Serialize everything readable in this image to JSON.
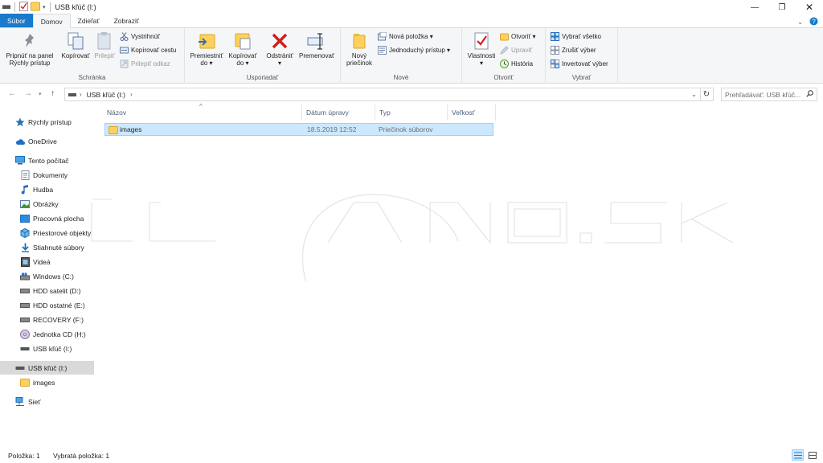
{
  "window": {
    "title": "USB kľúč (I:)",
    "controls": {
      "minimize": "—",
      "maximize": "❐",
      "close": "✕"
    }
  },
  "ribbon_tabs": [
    "Súbor",
    "Domov",
    "Zdieľať",
    "Zobraziť"
  ],
  "ribbon": {
    "clipboard": {
      "label": "Schránka",
      "pin": [
        "Pripnúť na panel",
        "Rýchly prístup"
      ],
      "copy": "Kopírovať",
      "paste": "Prilepiť",
      "cut": "Vystrihnúť",
      "copy_path": "Kopírovať cestu",
      "paste_shortcut": "Prilepiť odkaz"
    },
    "organize": {
      "label": "Usporiadať",
      "move_to": [
        "Premiestniť",
        "do ▾"
      ],
      "copy_to": [
        "Kopírovať",
        "do ▾"
      ],
      "delete": [
        "Odstrániť",
        "▾"
      ],
      "rename": "Premenovať"
    },
    "new": {
      "label": "Nové",
      "new_folder": [
        "Nový",
        "priečinok"
      ],
      "new_item": "Nová položka ▾",
      "easy_access": "Jednoduchý prístup ▾"
    },
    "open": {
      "label": "Otvoriť",
      "properties": [
        "Vlastnosti",
        "▾"
      ],
      "open": "Otvoriť ▾",
      "edit": "Upraviť",
      "history": "História"
    },
    "select": {
      "label": "Vybrať",
      "select_all": "Vybrať všetko",
      "select_none": "Zrušiť výber",
      "invert": "Invertovať výber"
    }
  },
  "address": {
    "path_segment": "USB kľúč (I:)",
    "search_placeholder": "Prehľadávať: USB kľúč..."
  },
  "nav_items": [
    "Rýchly prístup",
    "OneDrive",
    "Tento počítač",
    "Dokumenty",
    "Hudba",
    "Obrázky",
    "Pracovná plocha",
    "Priestorové objekty",
    "Stiahnuté súbory",
    "Videá",
    "Windows (C:)",
    "HDD satelit (D:)",
    "HDD ostatné (E:)",
    "RECOVERY (F:)",
    "Jednotka CD (H:)",
    "USB kľúč (I:)",
    "USB kľúč (I:)",
    "images",
    "Sieť"
  ],
  "columns": [
    "Názov",
    "Dátum úpravy",
    "Typ",
    "Veľkosť"
  ],
  "files": [
    {
      "name": "images",
      "modified": "18.5.2019 12:52",
      "type": "Priečinok súborov",
      "size": ""
    }
  ],
  "status": {
    "items": "Položka: 1",
    "selected": "Vybratá položka: 1"
  },
  "colors": {
    "file_tab": "#1979ca",
    "selection": "#cce8ff",
    "selection_border": "#99d1ff",
    "folder": "#ffd05c"
  }
}
